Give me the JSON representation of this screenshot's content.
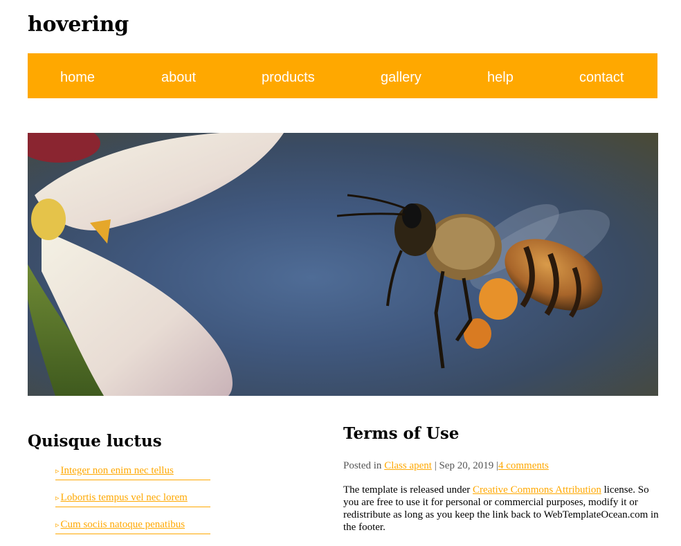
{
  "site": {
    "title": "hovering"
  },
  "nav": {
    "items": [
      "home",
      "about",
      "products",
      "gallery",
      "help",
      "contact"
    ]
  },
  "sidebar": {
    "title": "Quisque luctus",
    "links": [
      "Integer non enim nec tellus",
      "Lobortis tempus vel nec lorem",
      "Cum sociis natoque penatibus"
    ]
  },
  "article": {
    "title": "Terms of Use",
    "posted_in": "Posted in",
    "category": "Class apent",
    "date": " | Sep 20, 2019 |",
    "comments": "4 comments",
    "body_before": "The template is released under ",
    "body_link": "Creative Commons Attribution",
    "body_after": " license. So you are free to use it for personal or commercial purposes, modify it or redistribute as long as you keep the link back to WebTemplateOcean.com in the footer."
  },
  "colors": {
    "accent": "#ffa800",
    "nav_text": "#ffffff"
  }
}
